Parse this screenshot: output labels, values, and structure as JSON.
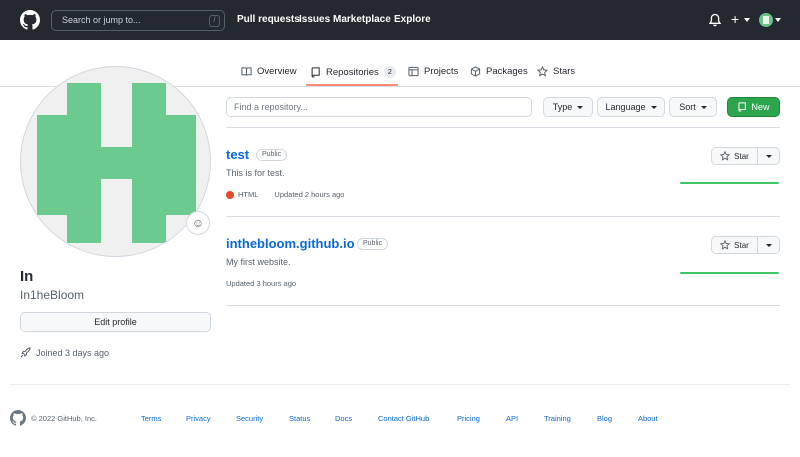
{
  "header": {
    "search_placeholder": "Search or jump to...",
    "slash_key": "/",
    "nav": [
      "Pull requests",
      "Issues",
      "Marketplace",
      "Explore"
    ],
    "plus_label": "+",
    "icons": [
      "github-logo-icon",
      "bell-icon",
      "plus-icon",
      "avatar"
    ]
  },
  "tabs": {
    "overview": "Overview",
    "repositories": "Repositories",
    "repositories_count": "2",
    "projects": "Projects",
    "packages": "Packages",
    "stars": "Stars"
  },
  "profile": {
    "name": "In",
    "username": "In1heBloom",
    "edit_button": "Edit profile",
    "joined": "Joined 3 days ago",
    "emoji_glyph": "☺",
    "avatar_colors": {
      "foreground": "#6bcb8e",
      "background": "#f0f0f0"
    }
  },
  "toolbar": {
    "find_placeholder": "Find a repository...",
    "type_label": "Type",
    "language_label": "Language",
    "sort_label": "Sort",
    "new_label": "New",
    "new_button_color": "#2da44e"
  },
  "repos": [
    {
      "name": "test",
      "visibility": "Public",
      "description": "This is for test.",
      "language": "HTML",
      "language_color": "#e34c26",
      "updated": "Updated 2 hours ago",
      "star_label": "Star"
    },
    {
      "name": "inthebloom.github.io",
      "visibility": "Public",
      "description": "My first website.",
      "updated": "Updated 3 hours ago",
      "star_label": "Star"
    }
  ],
  "footer": {
    "copyright": "© 2022 GitHub, Inc.",
    "links": [
      "Terms",
      "Privacy",
      "Security",
      "Status",
      "Docs",
      "Contact GitHub",
      "Pricing",
      "API",
      "Training",
      "Blog",
      "About"
    ]
  }
}
